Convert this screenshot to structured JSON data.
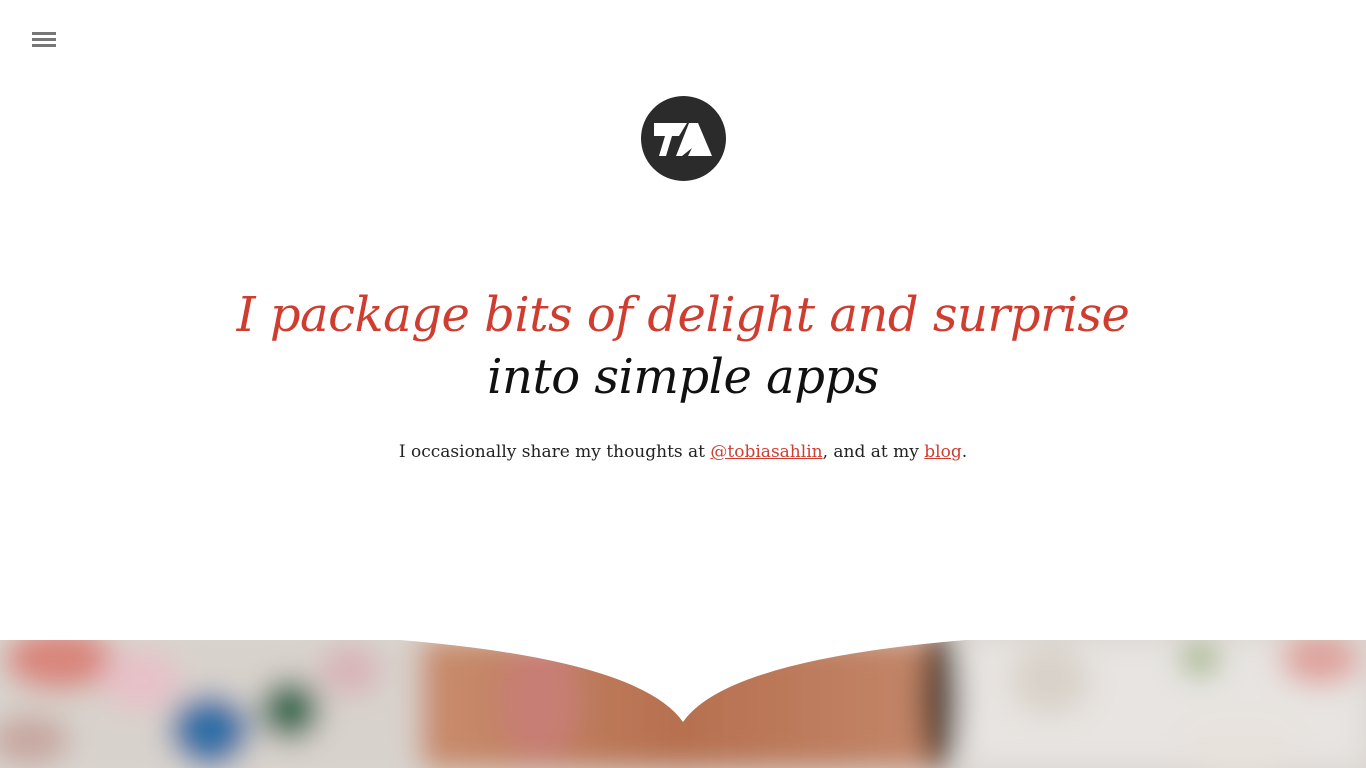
{
  "nav": {
    "menu_icon": "hamburger-menu-icon"
  },
  "logo": {
    "icon": "ta-logo-icon",
    "color": "#2b2b2b"
  },
  "headline": {
    "line1": "I package bits of delight and surprise",
    "line2": "into simple apps",
    "accent_color": "#cf3d30"
  },
  "byline": {
    "prefix": "I occasionally share my thoughts at ",
    "twitter_link": "@tobiasahlin",
    "middle": ", and at my ",
    "blog_link": "blog",
    "suffix": "."
  },
  "hero_image": {
    "description_icon": "blurred-photo-image"
  }
}
